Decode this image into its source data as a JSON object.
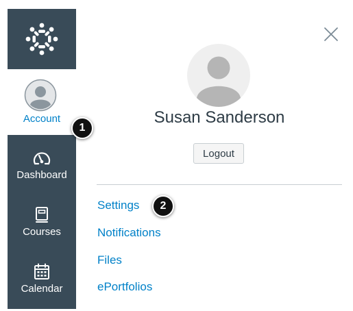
{
  "nav": {
    "account_label": "Account",
    "dashboard_label": "Dashboard",
    "courses_label": "Courses",
    "calendar_label": "Calendar"
  },
  "tray": {
    "user_name": "Susan Sanderson",
    "logout_label": "Logout",
    "links": [
      "Settings",
      "Notifications",
      "Files",
      "ePortfolios"
    ]
  },
  "callouts": [
    "1",
    "2"
  ],
  "colors": {
    "sidebar_bg": "#394B58",
    "link": "#0081C8",
    "text": "#2D3B45"
  },
  "icons": [
    "canvas-logo-icon",
    "avatar-icon",
    "dashboard-icon",
    "courses-icon",
    "calendar-icon",
    "close-icon"
  ]
}
